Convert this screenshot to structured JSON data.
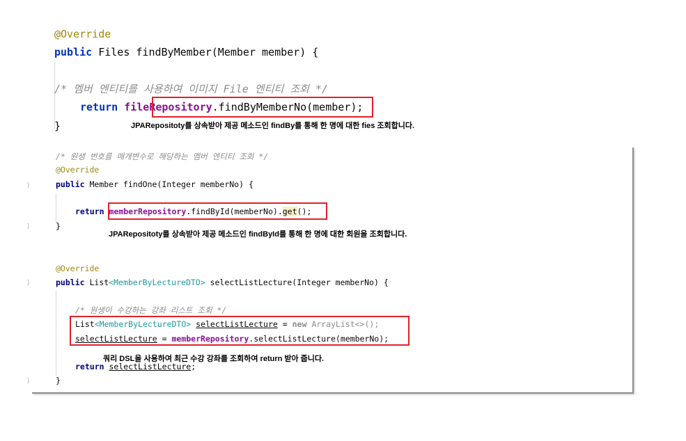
{
  "top": {
    "override": "@Override",
    "sig_kw": "public",
    "sig_rest": " Files findByMember(Member member) {",
    "comment": "/* 멤버 엔티티를 사용하여 이미지 File 엔티티 조회 */",
    "ret_kw": "return",
    "ret_var_pre": "file",
    "ret_var_box": "Repository",
    "ret_call": ".findByMemberNo(member)",
    "ret_end": ";",
    "close": "}",
    "note": "JPARepositoty를 상속받아 제공 메소드인 findBy를 통해 한 명에 대한 fies 조회합니다."
  },
  "panel": {
    "comment1": "/* 원생 번호를 매개변수로 해당하는 멤버 엔티티 조회 */",
    "override1": "@Override",
    "sig1_kw": "public",
    "sig1_rest": " Member findOne(Integer memberNo) {",
    "ret1_kw": "return",
    "ret1_field": "memberRepository",
    "ret1_call": ".findById(memberNo).",
    "ret1_get": "get",
    "ret1_end": "();",
    "close1": "}",
    "note1": "JPARepositoty를 상속받아 제공 메소드인 findById를 통해 한 명에 대한 회원을 조회합니다.",
    "override2": "@Override",
    "sig2_kw": "public",
    "sig2_type": " List",
    "sig2_gen": "<MemberByLectureDTO>",
    "sig2_rest": " selectListLecture(Integer memberNo) {",
    "comment2": "/* 원생이 수강하는 강좌 리스트 조회 */",
    "l1_type": "List",
    "l1_gen": "<MemberByLectureDTO>",
    "l1_var": "selectListLecture",
    "l1_eq": " = ",
    "l1_new": "new",
    "l1_rest": " ArrayList<>();",
    "l2_var": "selectListLecture",
    "l2_eq": " = ",
    "l2_field": "memberRepository",
    "l2_call": ".selectListLecture(memberNo);",
    "note2": "쿼리 DSL을 사용하여 최근 수강 강좌를 조회하여 return 받아 줍니다.",
    "ret2_kw": "return",
    "ret2_var": "selectListLecture",
    "ret2_end": ";",
    "close2": "}"
  },
  "colors": {
    "highlight_box": "#e0202a",
    "keyword": "#0033b3",
    "annotation": "#9e880d",
    "field": "#871094",
    "comment": "#8c8c8c"
  }
}
